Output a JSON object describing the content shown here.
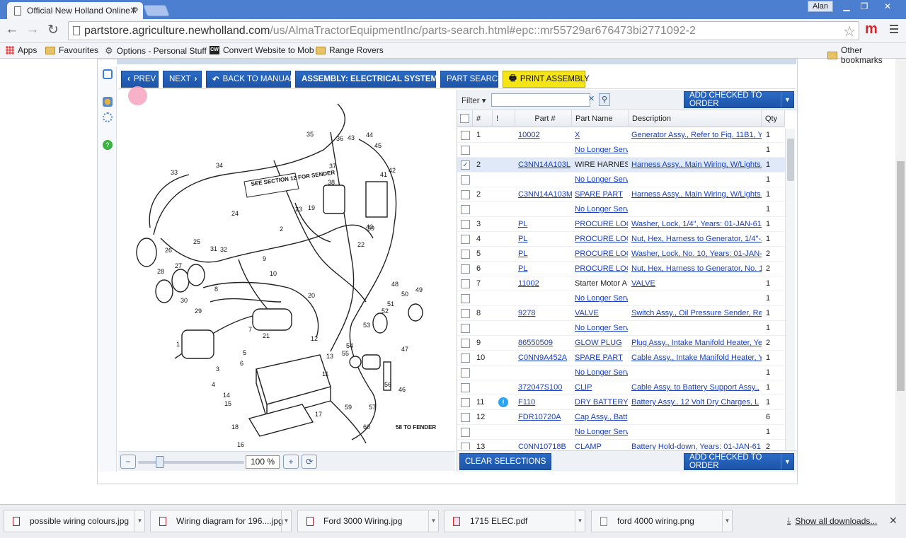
{
  "browser": {
    "tab_title": "Official New Holland Online P",
    "user_label": "Alan",
    "url_host": "partstore.agriculture.newholland.com",
    "url_path": "/us/AlmaTractorEquipmentInc/parts-search.html#epc::mr55729ar676473bi2771092-2",
    "bookmarks": [
      "Apps",
      "Favourites",
      "Options - Personal Stuff",
      "Convert Website to Mob",
      "Range Rovers"
    ],
    "other_bookmarks": "Other bookmarks"
  },
  "toolbar": {
    "prev": "PREV",
    "next": "NEXT",
    "back_to_manual": "BACK TO MANUAL",
    "assembly": "ASSEMBLY: ELECTRICAL SYSTEM...",
    "part_search": "PART SEARCH",
    "print_assembly": "PRINT ASSEMBLY"
  },
  "zoom": {
    "value": "100 %",
    "slider_level": 0.2
  },
  "panel": {
    "filter_label": "Filter",
    "add_checked": "ADD CHECKED TO ORDER",
    "clear_selections": "CLEAR SELECTIONS",
    "columns": [
      "#",
      "!",
      "Part #",
      "Part Name",
      "Description",
      "Qty"
    ],
    "rows": [
      {
        "checked": false,
        "num": "1",
        "info": false,
        "part": "10002",
        "name": "X",
        "name_link": true,
        "desc": "Generator Assy., Refer to Fig. 11B1, Y",
        "qty": "1"
      },
      {
        "checked": false,
        "num": "",
        "info": false,
        "part": "",
        "name": "No Longer Serv",
        "name_link": true,
        "desc": "",
        "qty": "1"
      },
      {
        "checked": true,
        "num": "2",
        "info": false,
        "part": "C3NN14A103L",
        "name": "WIRE HARNESS",
        "name_link": false,
        "desc": "Harness Assy., Main Wiring, W/Lights,",
        "qty": "1"
      },
      {
        "checked": false,
        "num": "",
        "info": false,
        "part": "",
        "name": "No Longer Serv",
        "name_link": true,
        "desc": "",
        "qty": "1"
      },
      {
        "checked": false,
        "num": "2",
        "info": false,
        "part": "C3NN14A103M",
        "name": "SPARE PART",
        "name_link": true,
        "desc": "Harness Assy., Main Wiring, W/Lights,",
        "qty": "1"
      },
      {
        "checked": false,
        "num": "",
        "info": false,
        "part": "",
        "name": "No Longer Serv",
        "name_link": true,
        "desc": "",
        "qty": "1"
      },
      {
        "checked": false,
        "num": "3",
        "info": false,
        "part": "PL",
        "name": "PROCURE LOC",
        "name_link": true,
        "desc": "Washer, Lock, 1/4\", Years: 01-JAN-61",
        "qty": "1"
      },
      {
        "checked": false,
        "num": "4",
        "info": false,
        "part": "PL",
        "name": "PROCURE LOC",
        "name_link": true,
        "desc": "Nut, Hex, Harness to Generator, 1/4\"-2",
        "qty": "1"
      },
      {
        "checked": false,
        "num": "5",
        "info": false,
        "part": "PL",
        "name": "PROCURE LOC",
        "name_link": true,
        "desc": "Washer, Lock, No. 10, Years: 01-JAN-",
        "qty": "2"
      },
      {
        "checked": false,
        "num": "6",
        "info": false,
        "part": "PL",
        "name": "PROCURE LOC",
        "name_link": true,
        "desc": "Nut, Hex, Harness to Generator, No. 1(",
        "qty": "2"
      },
      {
        "checked": false,
        "num": "7",
        "info": false,
        "part": "11002",
        "name": "Starter Motor A",
        "name_link": false,
        "desc": "VALVE",
        "qty": "1"
      },
      {
        "checked": false,
        "num": "",
        "info": false,
        "part": "",
        "name": "No Longer Serv",
        "name_link": true,
        "desc": "",
        "qty": "1"
      },
      {
        "checked": false,
        "num": "8",
        "info": false,
        "part": "9278",
        "name": "VALVE",
        "name_link": true,
        "desc": "Switch Assy., Oil Pressure Sender, Re",
        "qty": "1"
      },
      {
        "checked": false,
        "num": "",
        "info": false,
        "part": "",
        "name": "No Longer Serv",
        "name_link": true,
        "desc": "",
        "qty": "1"
      },
      {
        "checked": false,
        "num": "9",
        "info": false,
        "part": "86550509",
        "name": "GLOW PLUG",
        "name_link": true,
        "desc": "Plug Assy., Intake Manifold Heater, Yea",
        "qty": "2"
      },
      {
        "checked": false,
        "num": "10",
        "info": false,
        "part": "C0NN9A452A",
        "name": "SPARE PART",
        "name_link": true,
        "desc": "Cable Assy., Intake Manifold Heater, Y",
        "qty": "1"
      },
      {
        "checked": false,
        "num": "",
        "info": false,
        "part": "",
        "name": "No Longer Serv",
        "name_link": true,
        "desc": "",
        "qty": "1"
      },
      {
        "checked": false,
        "num": "",
        "info": false,
        "part": "372047S100",
        "name": "CLIP",
        "name_link": true,
        "desc": "Cable Assy. to Battery Support Assy.,",
        "qty": "1"
      },
      {
        "checked": false,
        "num": "11",
        "info": true,
        "part": "F110",
        "name": "DRY BATTERY",
        "name_link": true,
        "desc": "Battery Assy., 12 Volt Dry Charges, L",
        "qty": "1"
      },
      {
        "checked": false,
        "num": "12",
        "info": false,
        "part": "FDR10720A",
        "name": "Cap Assy., Batt",
        "name_link": true,
        "desc": "",
        "qty": "6"
      },
      {
        "checked": false,
        "num": "",
        "info": false,
        "part": "",
        "name": "No Longer Serv",
        "name_link": true,
        "desc": "",
        "qty": "1"
      },
      {
        "checked": false,
        "num": "13",
        "info": false,
        "part": "C0NN10718B",
        "name": "CLAMP",
        "name_link": true,
        "desc": "Battery Hold-down, Years: 01-JAN-61",
        "qty": "2"
      }
    ]
  },
  "diagram": {
    "callouts": [
      "1",
      "2",
      "3",
      "4",
      "5",
      "6",
      "7",
      "8",
      "9",
      "10",
      "11",
      "12",
      "13",
      "14",
      "15",
      "16",
      "17",
      "18",
      "19",
      "20",
      "21",
      "22",
      "23",
      "24",
      "25",
      "26",
      "27",
      "28",
      "29",
      "30",
      "31",
      "32",
      "33",
      "34",
      "35",
      "36",
      "37",
      "38",
      "39",
      "40",
      "41",
      "42",
      "43",
      "44",
      "45",
      "46",
      "47",
      "48",
      "49",
      "50",
      "51",
      "52",
      "53",
      "54",
      "55",
      "56",
      "57",
      "58",
      "59",
      "60"
    ],
    "note": "SEE SECTION 12 FOR SENDER",
    "to_fender": "58 TO FENDER"
  },
  "downloads": {
    "items": [
      "possible wiring colours.jpg",
      "Wiring diagram for 196....jpg",
      "Ford 3000 Wiring.jpg",
      "1715 ELEC.pdf",
      "ford 4000 wiring.png"
    ],
    "show_all": "Show all downloads..."
  }
}
